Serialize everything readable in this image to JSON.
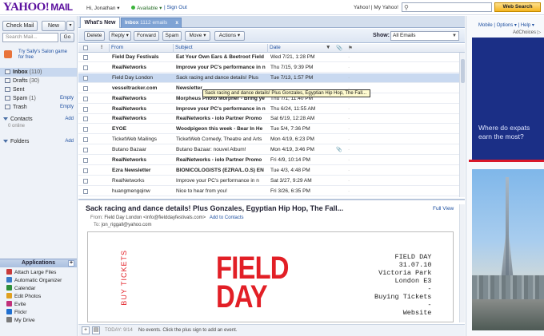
{
  "header": {
    "logo_yahoo": "YAHOO!",
    "logo_mail": "MAIL",
    "greeting": "Hi, Jonathan ▾",
    "status": "Available ▾",
    "signout": "| Sign Out",
    "links": "Yahoo! | My Yahoo!",
    "search_placeholder": "",
    "web_search": "Web Search"
  },
  "sidebar": {
    "check_mail": "Check Mail",
    "new": "New",
    "search_placeholder": "Search Mail...",
    "go": "Go",
    "promo": "Try Sally's Salon game for free",
    "folders": [
      {
        "label": "Inbox",
        "count": "(110)",
        "selected": true
      },
      {
        "label": "Drafts",
        "count": "(30)"
      },
      {
        "label": "Sent",
        "count": ""
      },
      {
        "label": "Spam",
        "count": "(1)",
        "action": "Empty"
      },
      {
        "label": "Trash",
        "count": "",
        "action": "Empty"
      }
    ],
    "contacts": {
      "label": "Contacts",
      "add": "Add"
    },
    "online": "0 online",
    "folders_section": {
      "label": "Folders",
      "add": "Add"
    },
    "applications_label": "Applications",
    "apps": [
      {
        "label": "Attach Large Files",
        "color": "#c83a3a"
      },
      {
        "label": "Automatic Organizer",
        "color": "#3a7bc8"
      },
      {
        "label": "Calendar",
        "color": "#2f8f3a"
      },
      {
        "label": "Edit Photos",
        "color": "#e0a020"
      },
      {
        "label": "Evite",
        "color": "#c0307a"
      },
      {
        "label": "Flickr",
        "color": "#1f6fd0"
      },
      {
        "label": "My Drive",
        "color": "#7a7a7a"
      }
    ]
  },
  "tabs": {
    "whats_new": "What's New",
    "inbox_label": "Inbox",
    "inbox_count": "1112 emails",
    "close": "x"
  },
  "toolbar": {
    "delete": "Delete",
    "reply": "Reply ▾",
    "forward": "Forward",
    "spam": "Spam",
    "move": "Move ▾",
    "actions": "Actions ▾",
    "show_label": "Show:",
    "show_value": "All Emails"
  },
  "list": {
    "columns": {
      "from": "From",
      "subject": "Subject",
      "date": "Date"
    },
    "tooltip": "Sack racing and dance details! Plus Gonzales, Egyptian Hip Hop, The Fall...",
    "rows": [
      {
        "from": "Field Day Festivals",
        "subject": "Eat Your Own Ears & Beetroot Field",
        "date": "Wed 7/21, 1:28 PM",
        "unread": true
      },
      {
        "from": "RealNetworks",
        "subject": "Improve your PC's performance in n",
        "date": "Thu 7/15, 9:39 PM",
        "unread": true
      },
      {
        "from": "Field Day London",
        "subject": "Sack racing and dance details! Plus",
        "date": "Tue 7/13, 1:57 PM",
        "selected": true
      },
      {
        "from": "vesseltracker.com",
        "subject": "Newsletter",
        "date": "",
        "unread": true
      },
      {
        "from": "RealNetworks",
        "subject": "Morpheus Photo Morpher - Bring ye",
        "date": "Thu 7/1, 11:40 PM",
        "unread": true
      },
      {
        "from": "RealNetworks",
        "subject": "Improve your PC's performance in n",
        "date": "Thu 6/24, 11:55 AM",
        "unread": true
      },
      {
        "from": "RealNetworks",
        "subject": "RealNetworks - iolo Partner Promo",
        "date": "Sat 6/19, 12:28 AM",
        "unread": true
      },
      {
        "from": "EYOE",
        "subject": "Woodpigeon this week - Bear In He",
        "date": "Tue 5/4, 7:36 PM",
        "unread": true
      },
      {
        "from": "TicketWeb Mailings",
        "subject": "TicketWeb Comedy, Theatre and Arts",
        "date": "Mon 4/19, 6:23 PM"
      },
      {
        "from": "Butano Bazaar",
        "subject": "Butano Bazaar: nouvel Album!",
        "date": "Mon 4/19, 3:46 PM",
        "attach": true
      },
      {
        "from": "RealNetworks",
        "subject": "RealNetworks - iolo Partner Promo",
        "date": "Fri 4/9, 10:14 PM",
        "unread": true
      },
      {
        "from": "Ezra Newsletter",
        "subject": "BIONICOLOGISTS (EZRA/L.O.S) EN",
        "date": "Tue 4/3, 4:48 PM",
        "unread": true
      },
      {
        "from": "RealNetworks",
        "subject": "Improve your PC's performance in n",
        "date": "Sat 3/27, 9:29 AM"
      },
      {
        "from": "huangmengqinw",
        "subject": "Nice to hear from you!",
        "date": "Fri 3/26, 6:35 PM"
      }
    ]
  },
  "pane": {
    "subject": "Sack racing and dance details! Plus Gonzales, Egyptian Hip Hop, The Fall...",
    "full_view": "Full View",
    "from_label": "From:",
    "from_value": "Field Day London <info@fielddayfestivals.com>",
    "add_contacts": "Add to Contacts",
    "to_label": "To:",
    "to_value": "jon_riggall@yahoo.com",
    "poster_title": "FIELD\nDAY",
    "poster_side": "BUY TICKETS",
    "poster_event": "FIELD DAY\n31.07.10\nVictoria Park\nLondon E3\n-\nBuying Tickets\n-\nWebsite"
  },
  "bottom": {
    "today": "TODAY: 9/14",
    "no_events": "No events. Click the plus sign to add an event."
  },
  "right": {
    "links": "Mobile | Options ▾ | Help ▾",
    "adchoices": "AdChoices ▷",
    "ad_text": "Where do expats earn the most?",
    "ad_accent": "#d8182a"
  }
}
